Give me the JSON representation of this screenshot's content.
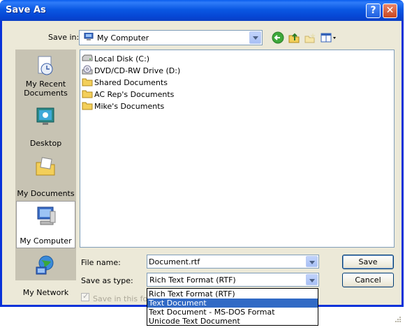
{
  "window": {
    "title": "Save As",
    "help_glyph": "?",
    "close_glyph": "✕"
  },
  "save_in": {
    "label": "Save in:",
    "value": "My Computer"
  },
  "places": [
    {
      "label": "My Recent Documents",
      "icon": "recent-documents-icon"
    },
    {
      "label": "Desktop",
      "icon": "desktop-icon"
    },
    {
      "label": "My Documents",
      "icon": "my-documents-icon"
    },
    {
      "label": "My Computer",
      "icon": "my-computer-icon",
      "selected": true
    },
    {
      "label": "My Network",
      "icon": "network-icon"
    }
  ],
  "files": [
    {
      "name": "Local Disk (C:)",
      "icon": "disk-icon"
    },
    {
      "name": "DVD/CD-RW Drive (D:)",
      "icon": "dvd-icon"
    },
    {
      "name": "Shared Documents",
      "icon": "folder-icon"
    },
    {
      "name": "AC Rep's Documents",
      "icon": "folder-icon"
    },
    {
      "name": "Mike's Documents",
      "icon": "folder-icon"
    }
  ],
  "file_name": {
    "label": "File name:",
    "value": "Document.rtf"
  },
  "save_as_type": {
    "label": "Save as type:",
    "value": "Rich Text Format (RTF)",
    "options": [
      "Rich Text Format (RTF)",
      "Text Document",
      "Text Document - MS-DOS Format",
      "Unicode Text Document"
    ],
    "highlighted": "Text Document"
  },
  "buttons": {
    "save": "Save",
    "cancel": "Cancel"
  },
  "checkbox": {
    "label": "Save in this form",
    "checked": true,
    "enabled": false
  },
  "colors": {
    "titlebar": "#0a58e3",
    "client": "#ece9d8",
    "highlight": "#316ac5"
  }
}
